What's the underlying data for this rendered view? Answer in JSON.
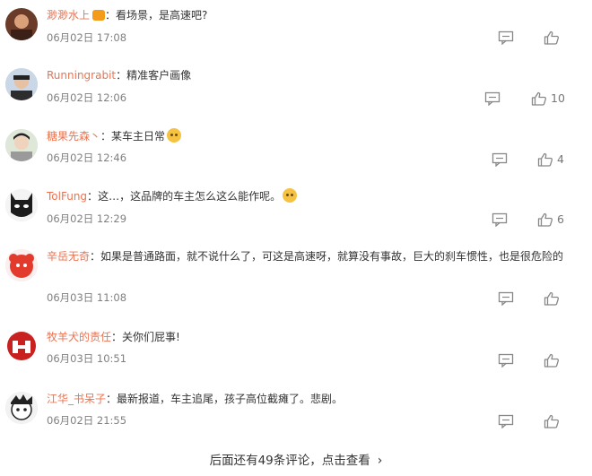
{
  "comments": [
    {
      "user": "渺渺水上",
      "sep": "：",
      "text": "看场景，是高速吧?",
      "time": "06月02日 17:08",
      "likes": ""
    },
    {
      "user": "Runningrabit",
      "sep": "：",
      "text": "精准客户画像",
      "time": "06月02日 12:06",
      "likes": "10"
    },
    {
      "user": "糖果先森丶",
      "sep": "：",
      "text": "某车主日常",
      "time": "06月02日 12:46",
      "likes": "4"
    },
    {
      "user": "TolFung",
      "sep": "：",
      "text": "这…，这品牌的车主怎么这么能作呢。",
      "time": "06月02日 12:29",
      "likes": "6"
    },
    {
      "user": "辛岳无奇",
      "sep": "：",
      "text": "如果是普通路面，就不说什么了，可这是高速呀，就算没有事故，巨大的刹车惯性，也是很危险的",
      "time": "06月03日 11:08",
      "likes": ""
    },
    {
      "user": "牧羊犬的责任",
      "sep": "：",
      "text": "关你们屁事!",
      "time": "06月03日 10:51",
      "likes": ""
    },
    {
      "user": "江华_书呆子",
      "sep": "：",
      "text": "最新报道，车主追尾，孩子高位截瘫了。悲剧。",
      "time": "06月02日 21:55",
      "likes": ""
    }
  ],
  "more_label": "后面还有49条评论，点击查看",
  "icons": {
    "reply": "comment-icon",
    "like": "thumbs-up-icon",
    "more": "chevron-right-icon"
  },
  "colors": {
    "username": "#eb7350",
    "time": "#808080"
  }
}
